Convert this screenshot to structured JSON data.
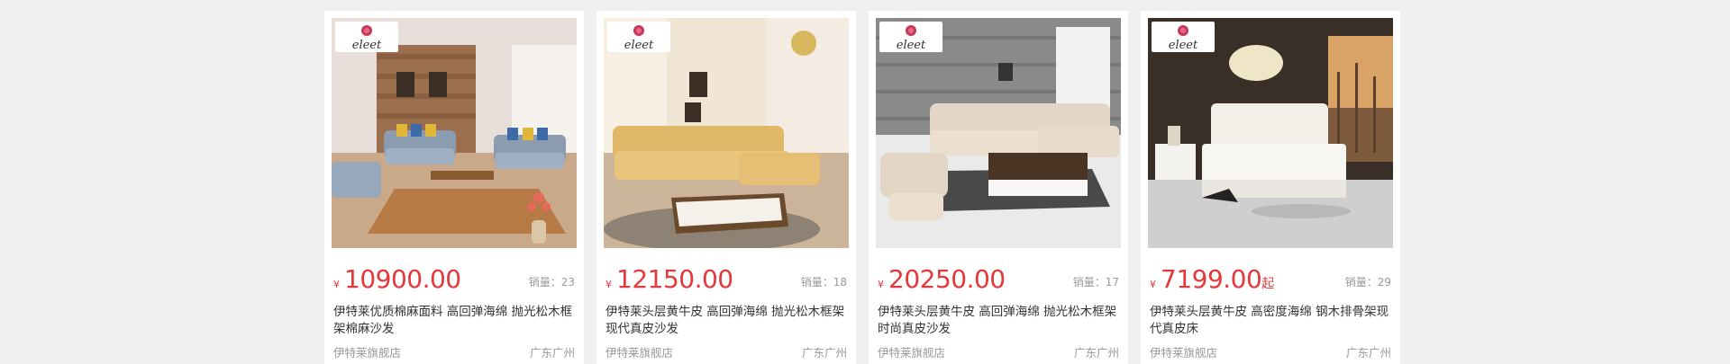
{
  "products": [
    {
      "brand": "eleet",
      "currency": "¥",
      "price": "10900.00",
      "suffix": "",
      "sales": "销量：23",
      "title": "伊特莱优质棉麻面料 高回弹海绵 抛光松木框架棉麻沙发",
      "shop": "伊特莱旗舰店",
      "location": "广东广州"
    },
    {
      "brand": "eleet",
      "currency": "¥",
      "price": "12150.00",
      "suffix": "",
      "sales": "销量：18",
      "title": "伊特莱头层黄牛皮 高回弹海绵 抛光松木框架现代真皮沙发",
      "shop": "伊特莱旗舰店",
      "location": "广东广州"
    },
    {
      "brand": "eleet",
      "currency": "¥",
      "price": "20250.00",
      "suffix": "",
      "sales": "销量：17",
      "title": "伊特莱头层黄牛皮 高回弹海绵 抛光松木框架时尚真皮沙发",
      "shop": "伊特莱旗舰店",
      "location": "广东广州"
    },
    {
      "brand": "eleet",
      "currency": "¥",
      "price": "7199.00",
      "suffix": "起",
      "sales": "销量：29",
      "title": "伊特莱头层黄牛皮 高密度海绵 钢木排骨架现代真皮床",
      "shop": "伊特莱旗舰店",
      "location": "广东广州"
    }
  ],
  "colors": {
    "price": "#e4393c",
    "muted": "#999999",
    "text": "#333333"
  }
}
